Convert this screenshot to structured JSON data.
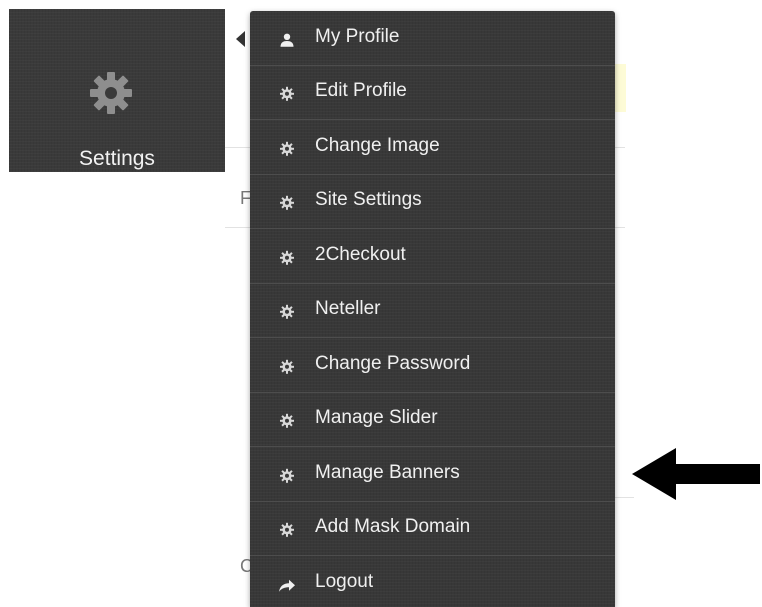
{
  "settings_tile": {
    "label": "Settings",
    "icon": "gear-icon",
    "background": "#3a3a3a"
  },
  "menu": {
    "background": "#383838",
    "items": [
      {
        "label": "My Profile",
        "icon": "user-icon"
      },
      {
        "label": "Edit Profile",
        "icon": "gear-icon"
      },
      {
        "label": "Change Image",
        "icon": "gear-icon"
      },
      {
        "label": "Site Settings",
        "icon": "gear-icon"
      },
      {
        "label": "2Checkout",
        "icon": "gear-icon"
      },
      {
        "label": "Neteller",
        "icon": "gear-icon"
      },
      {
        "label": "Change Password",
        "icon": "gear-icon"
      },
      {
        "label": "Manage Slider",
        "icon": "gear-icon"
      },
      {
        "label": "Manage Banners",
        "icon": "gear-icon"
      },
      {
        "label": "Add Mask Domain",
        "icon": "gear-icon"
      },
      {
        "label": "Logout",
        "icon": "share-arrow-icon"
      }
    ]
  },
  "annotation": {
    "icon": "left-arrow-icon",
    "points_to": "Manage Banners",
    "color": "#000000"
  },
  "background_page": {
    "glyphs": [
      "F",
      "C"
    ]
  }
}
